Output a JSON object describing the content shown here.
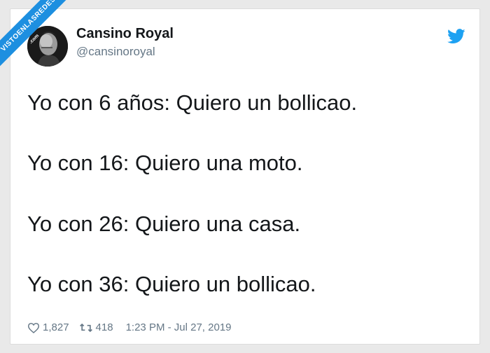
{
  "user": {
    "display_name": "Cansino Royal",
    "handle": "@cansinoroyal",
    "avatar_icon": "profile-photo"
  },
  "brand": {
    "icon": "twitter-bird-icon",
    "color": "#1da1f2"
  },
  "tweet": {
    "lines": [
      "Yo con 6 años: Quiero un bollicao.",
      "Yo con 16: Quiero una moto.",
      "Yo con 26: Quiero una casa.",
      "Yo con 36: Quiero un bollicao."
    ]
  },
  "stats": {
    "likes": "1,827",
    "retweets": "418",
    "timestamp": "1:23 PM - Jul 27, 2019"
  },
  "watermark": {
    "text": "VISTOENLASREDES",
    "suffix": ".com",
    "color": "#1d8fe0"
  }
}
